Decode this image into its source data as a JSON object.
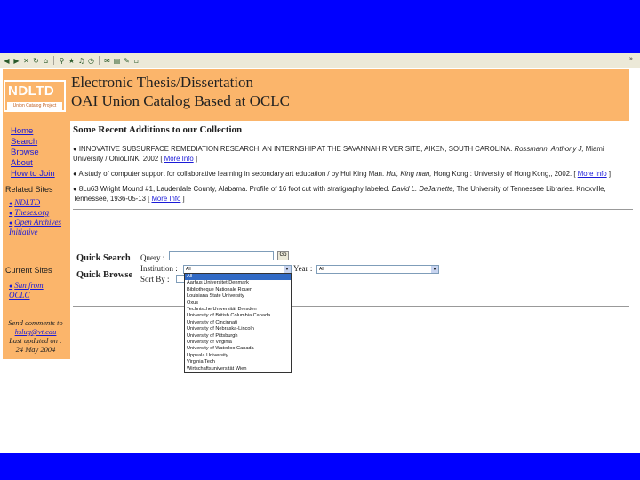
{
  "toolbar": {
    "icons": [
      "back-icon",
      "forward-icon",
      "stop-icon",
      "refresh-icon",
      "home-icon",
      "search-icon",
      "favorites-icon",
      "media-icon",
      "history-icon",
      "mail-icon",
      "print-icon",
      "edit-icon",
      "discuss-icon"
    ],
    "right_text": "»"
  },
  "header": {
    "logo_main": "NDLTD",
    "logo_sub": "Union Catalog Project",
    "title_line1": "Electronic Thesis/Dissertation",
    "title_line2": "OAI Union Catalog Based at OCLC"
  },
  "sidebar": {
    "nav": [
      "Home",
      "Search",
      "Browse",
      "About",
      "How to Join"
    ],
    "related_heading": "Related Sites",
    "related": [
      "NDLTD",
      "Theses.org",
      "Open Archives Initiative"
    ],
    "current_heading": "Current Sites",
    "current": [
      "Sun from OCLC"
    ],
    "contact_line1": "Send comments to",
    "contact_email": "hslug@vt.edu",
    "contact_line2": "Last updated on :",
    "contact_date": "24 May 2004"
  },
  "main": {
    "recent_title": "Some Recent Additions to our Collection",
    "entries": [
      {
        "text": "INNOVATIVE SUBSURFACE REMEDIATION RESEARCH, AN INTERNSHIP AT THE SAVANNAH RIVER SITE, AIKEN, SOUTH CAROLINA.",
        "author": "Rossmann, Anthony J,",
        "rest": "Miami University / OhioLINK, 2002 [",
        "link": "More Info",
        "end": "]"
      },
      {
        "text": "A study of computer support for collaborative learning in secondary art education / by Hui King Man.",
        "author": "Hui, King man,",
        "rest": "Hong Kong : University of Hong Kong,, 2002.",
        "link": "More Info",
        "end": "]"
      },
      {
        "text": "8Lu63 Wright Mound #1, Lauderdale County, Alabama. Profile of 16 foot cut with stratigraphy labeled.",
        "author": "David L. DeJarnette,",
        "rest": "The University of Tennessee Libraries. Knoxville, Tennessee, 1936-05-13 [",
        "link": "More Info",
        "end": "]"
      }
    ],
    "quick_search_label": "Quick Search",
    "query_label": "Query :",
    "go_label": "Go",
    "quick_browse_label": "Quick Browse",
    "institution_label": "Institution :",
    "institution_value": "All",
    "year_label": "Year :",
    "year_value": "All",
    "sort_label": "Sort By :"
  },
  "dropdown_options": [
    "All",
    "Aarhus Universitet Denmark",
    "Bibliotheque Nationale Rouen",
    "Louisiana State University",
    "Oxus",
    "Technische Universität Dresden",
    "University of British Columbia Canada",
    "University of Cincinnati",
    "University of Nebraska-Lincoln",
    "University of Pittsburgh",
    "University of Virginia",
    "University of Waterloo Canada",
    "Uppsala University",
    "Virginia Tech",
    "Wirtschaftsuniversität Wien"
  ]
}
